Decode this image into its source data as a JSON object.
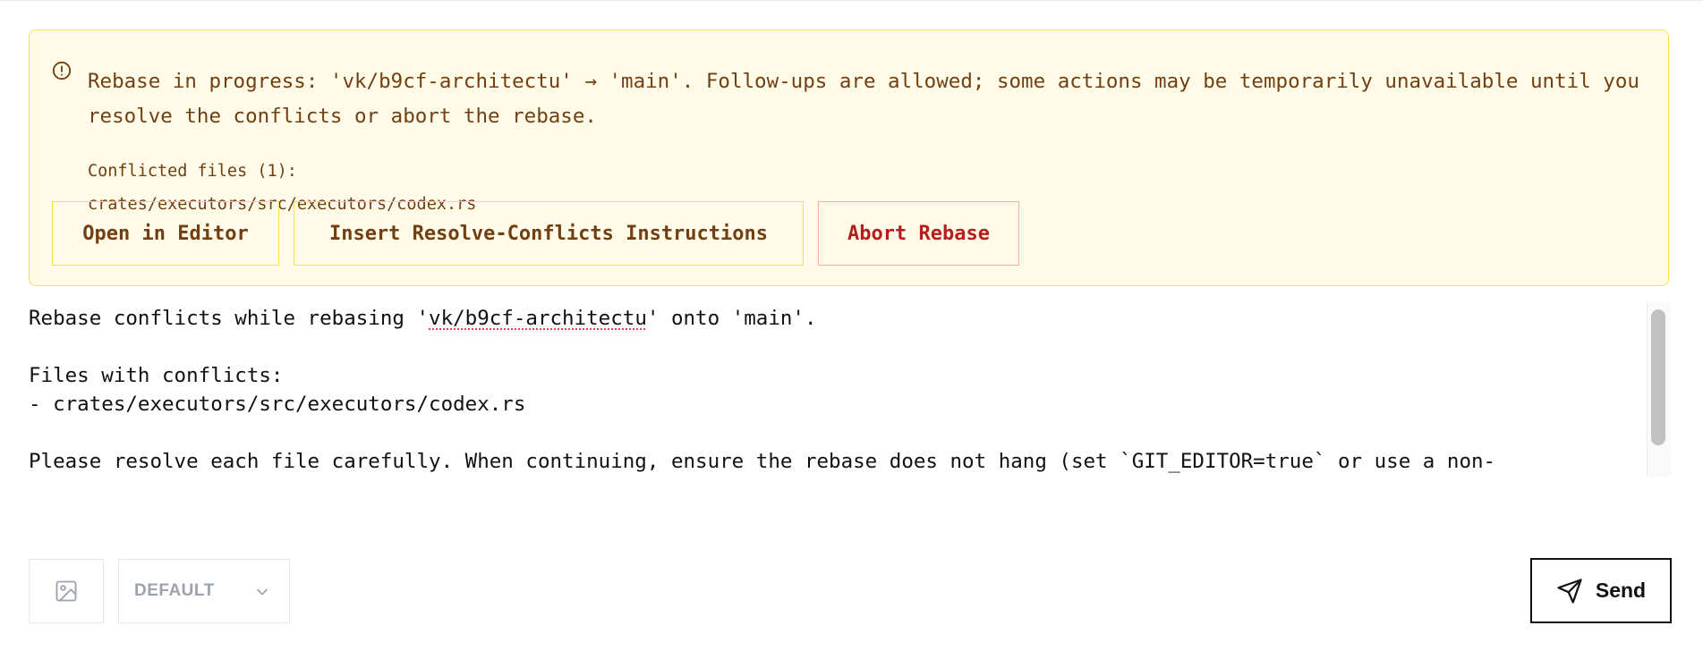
{
  "banner": {
    "message": "Rebase in progress: 'vk/b9cf-architectu' → 'main'. Follow-ups are allowed; some actions may be temporarily unavailable until you resolve the conflicts or abort the rebase.",
    "conflicted_label": "Conflicted files (1):",
    "conflicted_files": [
      "crates/executors/src/executors/codex.rs"
    ],
    "buttons": {
      "open_editor": "Open in Editor",
      "insert_instructions": "Insert Resolve-Conflicts Instructions",
      "abort": "Abort Rebase"
    },
    "icon": "info-circle-icon"
  },
  "editor": {
    "lines": [
      "Rebase conflicts while rebasing 'vk/b9cf-architectu' onto 'main'.",
      "",
      "Files with conflicts:",
      "- crates/executors/src/executors/codex.rs",
      "",
      "Please resolve each file carefully. When continuing, ensure the rebase does not hang (set `GIT_EDITOR=true` or use a non-"
    ],
    "line1_parts": [
      "Rebase conflicts while rebasing '",
      "vk/b9cf-architectu",
      "' onto 'main'."
    ]
  },
  "toolbar": {
    "image_icon": "image-icon",
    "variant_selected": "DEFAULT",
    "send_label": "Send",
    "send_icon": "send-icon"
  },
  "colors": {
    "banner_bg": "#fefce8",
    "banner_border": "#fde047",
    "banner_text": "#713f12",
    "abort_text": "#b91c1c",
    "abort_border": "#f9a8b4"
  }
}
